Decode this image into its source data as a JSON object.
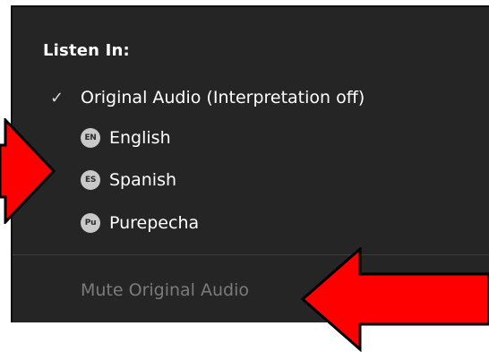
{
  "menu": {
    "header": "Listen In:",
    "original_audio": {
      "label": "Original Audio (Interpretation off)",
      "checked": true,
      "check_glyph": "✓"
    },
    "languages": [
      {
        "badge": "EN",
        "label": "English"
      },
      {
        "badge": "ES",
        "label": "Spanish"
      },
      {
        "badge": "Pu",
        "label": "Purepecha"
      }
    ],
    "mute_original": {
      "label": "Mute Original Audio",
      "state": "disabled"
    }
  },
  "annotations": {
    "arrow_color": "#ff0000",
    "arrow_outline_color": "#000000",
    "arrows": [
      {
        "direction": "right",
        "target": "Spanish"
      },
      {
        "direction": "left",
        "target": "Mute Original Audio"
      }
    ]
  }
}
